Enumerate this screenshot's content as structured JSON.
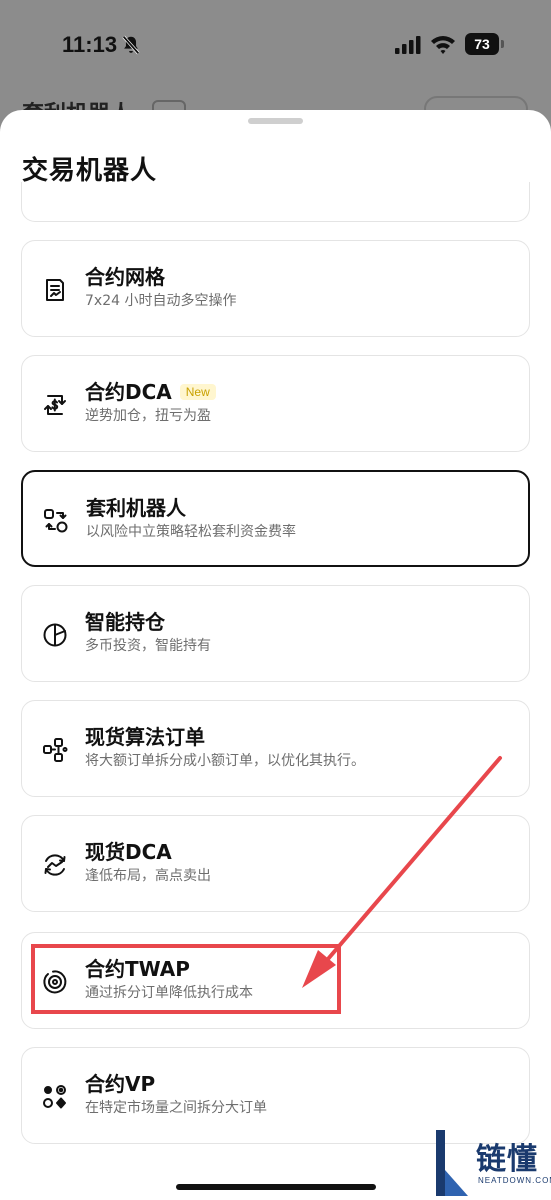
{
  "status_bar": {
    "time": "11:13",
    "battery": "73"
  },
  "background_page": {
    "title": "套利机器人"
  },
  "sheet": {
    "title": "交易机器人",
    "items": [
      {
        "title": "合约网格",
        "subtitle": "7x24 小时自动多空操作",
        "icon": "document-chart-icon"
      },
      {
        "title": "合约DCA",
        "subtitle": "逆势加仓，扭亏为盈",
        "badge": "New",
        "icon": "dollar-exchange-icon"
      },
      {
        "title": "套利机器人",
        "subtitle": "以风险中立策略轻松套利资金费率",
        "icon": "arbitrage-arrows-icon",
        "selected": true
      },
      {
        "title": "智能持仓",
        "subtitle": "多币投资，智能持有",
        "icon": "pie-chart-icon"
      },
      {
        "title": "现货算法订单",
        "subtitle": "将大额订单拆分成小额订单，以优化其执行。",
        "icon": "nodes-split-icon"
      },
      {
        "title": "现货DCA",
        "subtitle": "逢低布局，高点卖出",
        "icon": "cycle-trend-icon"
      },
      {
        "title": "合约TWAP",
        "subtitle": "通过拆分订单降低执行成本",
        "icon": "target-rings-icon"
      },
      {
        "title": "合约VP",
        "subtitle": "在特定市场量之间拆分大订单",
        "icon": "dots-grid-icon"
      }
    ]
  },
  "annotation": {
    "color": "#e8474c"
  },
  "watermark": {
    "text": "链懂",
    "sub": "NEATDOWN.COM"
  }
}
